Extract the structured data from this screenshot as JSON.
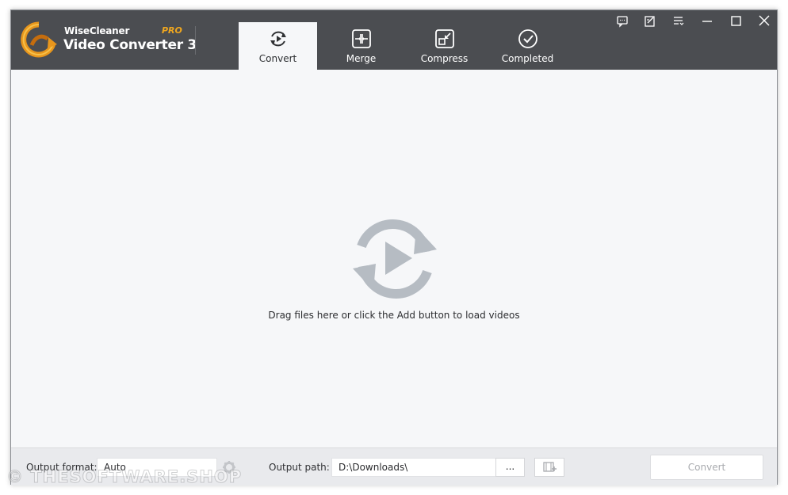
{
  "app": {
    "brand_top": "WiseCleaner",
    "brand_pro": "PRO",
    "brand_main": "Video Converter 3"
  },
  "tabs": [
    {
      "label": "Convert",
      "icon": "convert-icon",
      "active": true
    },
    {
      "label": "Merge",
      "icon": "merge-icon",
      "active": false
    },
    {
      "label": "Compress",
      "icon": "compress-icon",
      "active": false
    },
    {
      "label": "Completed",
      "icon": "check-circle-icon",
      "active": false
    }
  ],
  "window_controls": [
    "feedback-icon",
    "edit-icon",
    "menu-icon",
    "minimize-icon",
    "maximize-icon",
    "close-icon"
  ],
  "main": {
    "hint": "Drag files here or click the Add button to load videos",
    "icon": "convert-play-icon"
  },
  "bottom": {
    "output_format_label": "Output format:",
    "output_format_value": "Auto",
    "output_path_label": "Output path:",
    "output_path_value": "D:\\Downloads\\",
    "browse_label": "...",
    "convert_label": "Convert"
  },
  "watermark": "© THESOFTWARE.SHOP",
  "colors": {
    "titlebar": "#4b4d51",
    "accent": "#f0a71f",
    "content_bg": "#f6f7f9",
    "icon_gray": "#b6bcc3"
  }
}
